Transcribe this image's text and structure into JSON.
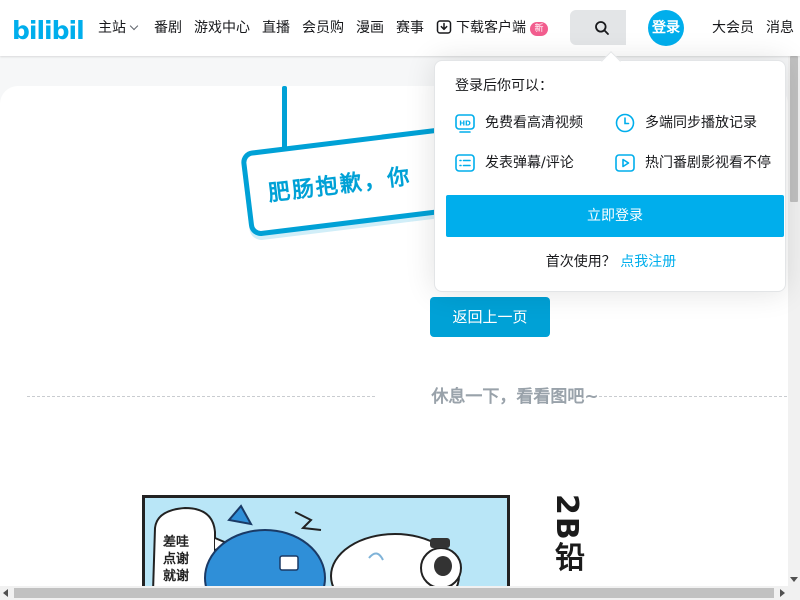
{
  "header": {
    "logo_text": "bilibili",
    "nav": [
      {
        "label": "主站",
        "dropdown": true
      },
      {
        "label": "番剧"
      },
      {
        "label": "游戏中心"
      },
      {
        "label": "直播"
      },
      {
        "label": "会员购"
      },
      {
        "label": "漫画"
      },
      {
        "label": "赛事"
      }
    ],
    "download": {
      "label": "下载客户端",
      "badge": "新"
    },
    "login_label": "登录",
    "vip_label": "大会员",
    "message_label": "消息"
  },
  "error_page": {
    "sign_text": "肥肠抱歉，你",
    "back_button": "返回上一页",
    "rest_text": "休息一下，看看图吧~"
  },
  "comic": {
    "bubble_text": [
      "差哇",
      "点谢",
      "就谢"
    ],
    "side_text": "2B铅"
  },
  "login_popup": {
    "title": "登录后你可以：",
    "perks": [
      {
        "icon": "hd-icon",
        "label": "免费看高清视频"
      },
      {
        "icon": "clock-icon",
        "label": "多端同步播放记录"
      },
      {
        "icon": "list-icon",
        "label": "发表弹幕/评论"
      },
      {
        "icon": "play-icon",
        "label": "热门番剧影视看不停"
      }
    ],
    "login_button": "立即登录",
    "first_use_text": "首次使用？",
    "register_link": "点我注册"
  },
  "colors": {
    "brand_blue": "#00aeec",
    "badge_pink": "#f25d8e"
  }
}
